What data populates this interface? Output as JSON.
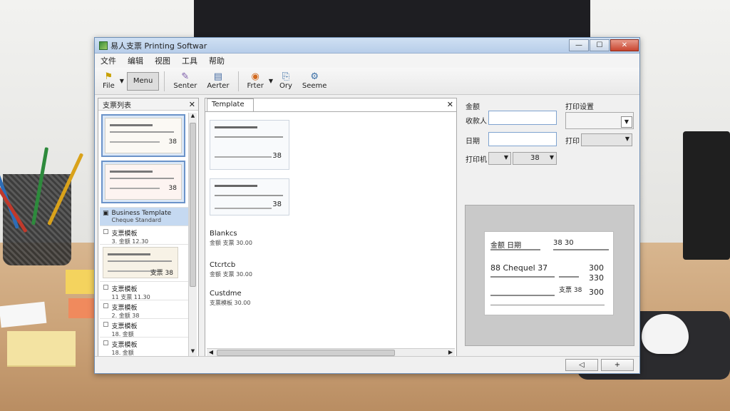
{
  "window": {
    "title": "易人支票 Printing Softwar",
    "controls": {
      "minimize": "—",
      "maximize": "☐",
      "close": "✕"
    }
  },
  "menu": [
    "文件",
    "编辑",
    "视图",
    "工具",
    "帮助"
  ],
  "toolbar": [
    {
      "label": "File",
      "icon": "flag-icon"
    },
    {
      "label": "Menu",
      "icon": "",
      "boxed": true
    },
    {
      "label": "Senter",
      "icon": "pen-icon"
    },
    {
      "label": "Aerter",
      "icon": "document-icon"
    },
    {
      "label": "Frter",
      "icon": "globe-icon"
    },
    {
      "label": "Ory",
      "icon": "copy-icon"
    },
    {
      "label": "Seeme",
      "icon": "settings-icon"
    }
  ],
  "left_panel": {
    "title": "支票列表",
    "close": "✕",
    "thumbs": [
      {
        "amount": "38"
      },
      {
        "amount": "38"
      }
    ],
    "items": [
      {
        "title": "Business Template",
        "sub": "Cheque Standard",
        "selected": true
      },
      {
        "title": "支票模板",
        "sub": "3. 金额 12.30",
        "selected": false
      },
      {
        "title": "",
        "sub": "支票 38",
        "selected": false,
        "check": true
      },
      {
        "title": "支票模板",
        "sub": "11 支票 11.30",
        "selected": false
      },
      {
        "title": "支票模板",
        "sub": "2. 金额 38",
        "selected": false
      },
      {
        "title": "支票模板",
        "sub": "18. 金额",
        "selected": false
      },
      {
        "title": "支票模板",
        "sub": "18. 金额",
        "selected": false
      }
    ]
  },
  "center_panel": {
    "tab": "Template",
    "close": "✕",
    "templates": [
      {
        "amount": "38",
        "name": "",
        "desc": ""
      },
      {
        "amount": "38",
        "name": "",
        "desc": ""
      },
      {
        "amount": "",
        "name": "Blankcs",
        "desc": "金额 支票 30.00"
      },
      {
        "amount": "",
        "name": "Ctcrtcb",
        "desc": "金额 支票 30.00"
      },
      {
        "amount": "",
        "name": "Custdme",
        "desc": "支票模板 30.00"
      }
    ]
  },
  "right_panel": {
    "label_amount": "金额",
    "label_payee": "收款人",
    "label_date": "日期",
    "label_print": "打印设置",
    "label_print2": "打印",
    "label_printer": "打印机",
    "printer_value": "38",
    "preview": {
      "header_left": "金额 日期",
      "header_right": "38 30",
      "line1": "88 Chequel 37",
      "amount1": "300",
      "amount2": "330",
      "amount3": "300",
      "small": "支票 38"
    }
  },
  "bottom": {
    "btn_back": "◁",
    "btn_add": "+"
  }
}
